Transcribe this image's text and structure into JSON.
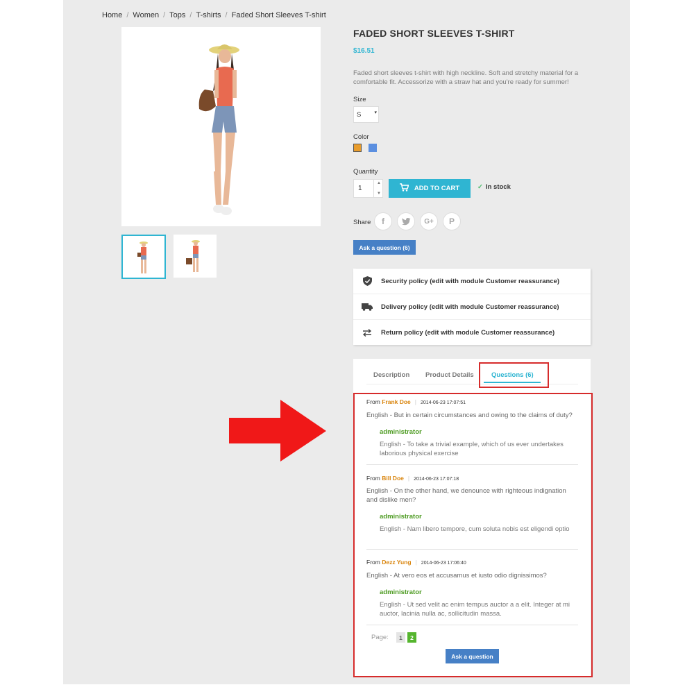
{
  "breadcrumb": [
    "Home",
    "Women",
    "Tops",
    "T-shirts",
    "Faded Short Sleeves T-shirt"
  ],
  "product": {
    "title": "FADED SHORT SLEEVES T-SHIRT",
    "price": "$16.51",
    "description": "Faded short sleeves t-shirt with high neckline. Soft and stretchy material for a comfortable fit. Accessorize with a straw hat and you're ready for summer!",
    "size_label": "Size",
    "size_value": "S",
    "color_label": "Color",
    "colors": [
      "#e89c2c",
      "#5b8fe0"
    ],
    "quantity_label": "Quantity",
    "quantity_value": "1",
    "add_to_cart": "ADD TO CART",
    "stock": "In stock",
    "share_label": "Share",
    "social": [
      "facebook",
      "twitter",
      "google-plus",
      "pinterest"
    ],
    "ask_button": "Ask a question (6)"
  },
  "reassurance": [
    "Security policy (edit with module Customer reassurance)",
    "Delivery policy (edit with module Customer reassurance)",
    "Return policy (edit with module Customer reassurance)"
  ],
  "tabs": [
    "Description",
    "Product Details",
    "Questions (6)"
  ],
  "questions": [
    {
      "from": "From",
      "name": "Frank Doe",
      "date": "2014-06-23 17:07:51",
      "question": "English - But in certain circumstances and owing to the claims of duty?",
      "answerer": "administrator",
      "answer": "English - To take a trivial example, which of us ever undertakes laborious physical exercise"
    },
    {
      "from": "From",
      "name": "Bill Doe",
      "date": "2014-06-23 17:07:18",
      "question": "English - On the other hand, we denounce with righteous indignation and dislike men?",
      "answerer": "administrator",
      "answer": "English - Nam libero tempore, cum soluta nobis est eligendi optio"
    },
    {
      "from": "From",
      "name": "Dezz Yung",
      "date": "2014-06-23 17:06:40",
      "question": "English - At vero eos et accusamus et iusto odio dignissimos?",
      "answerer": "administrator",
      "answer": "English - Ut sed velit ac enim tempus auctor a a elit. Integer at mi auctor, lacinia nulla ac, sollicitudin massa."
    }
  ],
  "pagination": {
    "label": "Page:",
    "pages": [
      "1",
      "2"
    ],
    "current": "2"
  },
  "ask_question_button": "Ask a question"
}
